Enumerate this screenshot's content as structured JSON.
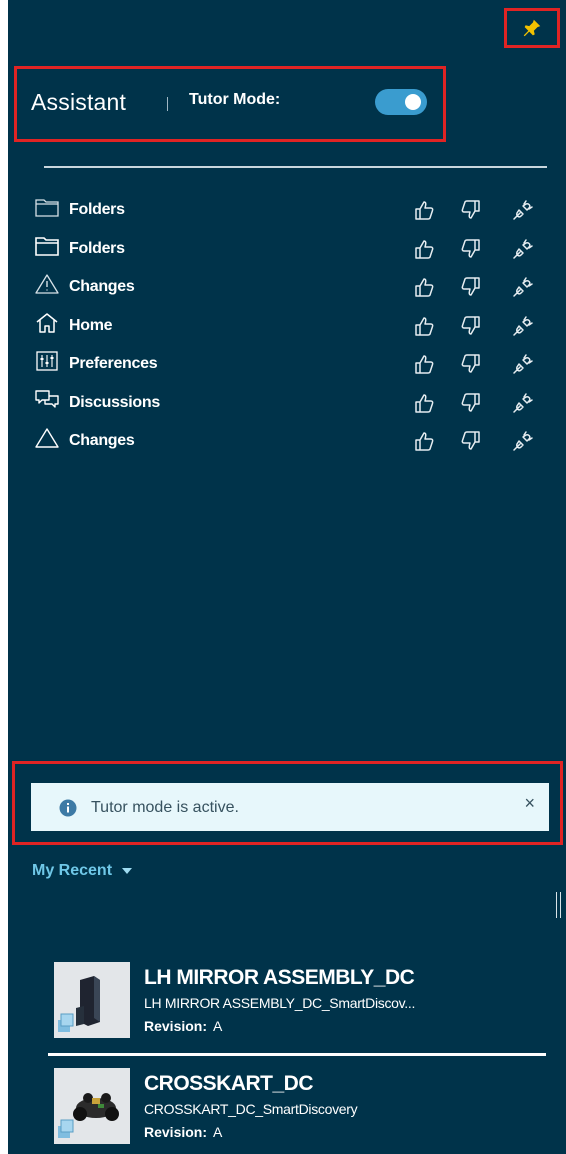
{
  "header": {
    "title": "Assistant",
    "tutor_mode_label": "Tutor Mode:",
    "tutor_mode_enabled": true
  },
  "features": [
    {
      "label": "Folders",
      "icon": "folder-icon"
    },
    {
      "label": "Folders",
      "icon": "folder-icon"
    },
    {
      "label": "Changes",
      "icon": "warning-icon"
    },
    {
      "label": "Home",
      "icon": "home-icon"
    },
    {
      "label": "Preferences",
      "icon": "sliders-icon"
    },
    {
      "label": "Discussions",
      "icon": "chat-icon"
    },
    {
      "label": "Changes",
      "icon": "triangle-icon"
    }
  ],
  "notice": {
    "text": "Tutor mode is active.",
    "close_label": "×"
  },
  "recent": {
    "label": "My Recent",
    "revision_label": "Revision:",
    "items": [
      {
        "title": "LH MIRROR ASSEMBLY_DC",
        "subtitle": "LH MIRROR ASSEMBLY_DC_SmartDiscov...",
        "revision": "A"
      },
      {
        "title": "CROSSKART_DC",
        "subtitle": "CROSSKART_DC_SmartDiscovery",
        "revision": "A"
      }
    ]
  },
  "colors": {
    "panel_bg": "#00334a",
    "highlight": "#e02424",
    "toggle": "#3a9ccf",
    "notice_bg": "#e7f7fb",
    "accent_text": "#6fc8e8",
    "pin": "#f2c200"
  }
}
